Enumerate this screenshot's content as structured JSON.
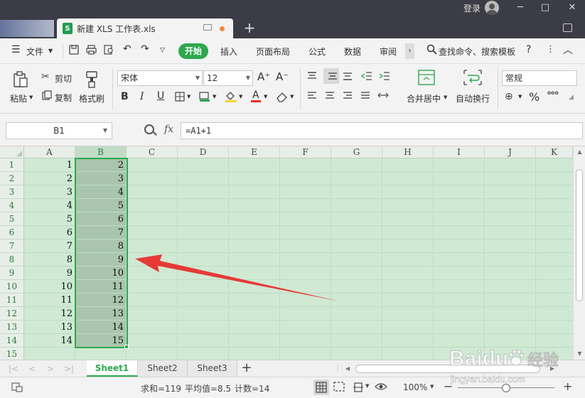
{
  "titlebar": {
    "doc_tab": "新建 XLS 工作表.xls",
    "xls_icon": "S",
    "login": "登录",
    "new_tab": "+",
    "min": "─",
    "max": "□",
    "close": "✕"
  },
  "menu": {
    "file": "文件",
    "start": "开始",
    "items": [
      "插入",
      "页面布局",
      "公式",
      "数据",
      "审阅"
    ],
    "search": "查找命令、搜索模板",
    "help": "?",
    "more": "⋮",
    "collapse": "︿"
  },
  "ribbon": {
    "paste": "粘贴",
    "cut": "剪切",
    "copy": "复制",
    "format_painter": "格式刷",
    "font_name": "宋体",
    "font_size": "12",
    "bold": "B",
    "italic": "I",
    "underline": "U",
    "font_color": "A",
    "grow": "A⁺",
    "shrink": "A⁻",
    "merge": "合并居中",
    "wrap": "自动换行",
    "number_format": "常规",
    "percent": "%"
  },
  "formula_bar": {
    "name_box": "B1",
    "fx": "fx",
    "formula": "=A1+1"
  },
  "grid": {
    "columns": [
      "A",
      "B",
      "C",
      "D",
      "E",
      "F",
      "G",
      "H",
      "I",
      "J",
      "K"
    ],
    "selected_column": "B",
    "rows": [
      {
        "row": "1",
        "a": "1",
        "b": "2"
      },
      {
        "row": "2",
        "a": "2",
        "b": "3"
      },
      {
        "row": "3",
        "a": "3",
        "b": "4"
      },
      {
        "row": "4",
        "a": "4",
        "b": "5"
      },
      {
        "row": "5",
        "a": "5",
        "b": "6"
      },
      {
        "row": "6",
        "a": "6",
        "b": "7"
      },
      {
        "row": "7",
        "a": "7",
        "b": "8"
      },
      {
        "row": "8",
        "a": "8",
        "b": "9"
      },
      {
        "row": "9",
        "a": "9",
        "b": "10"
      },
      {
        "row": "10",
        "a": "10",
        "b": "11"
      },
      {
        "row": "11",
        "a": "11",
        "b": "12"
      },
      {
        "row": "12",
        "a": "12",
        "b": "13"
      },
      {
        "row": "13",
        "a": "13",
        "b": "14"
      },
      {
        "row": "14",
        "a": "14",
        "b": "15"
      },
      {
        "row": "15",
        "a": "",
        "b": ""
      }
    ]
  },
  "sheets": {
    "tabs": [
      "Sheet1",
      "Sheet2",
      "Sheet3"
    ],
    "active": "Sheet1",
    "add": "+"
  },
  "status": {
    "sum": "求和=119",
    "average": "平均值=8.5",
    "count": "计数=14",
    "zoom": "100%",
    "zoom_minus": "−",
    "zoom_plus": "+"
  },
  "watermark": {
    "brand": "Baidu",
    "suffix": "经验",
    "url": "jingyan.baidu.com"
  },
  "colors": {
    "accent": "#2ea84f",
    "titlebar": "#3c3c46",
    "grid_bg": "#cfe9d3",
    "selection": "#a9c5ae",
    "arrow": "#e8302e"
  }
}
